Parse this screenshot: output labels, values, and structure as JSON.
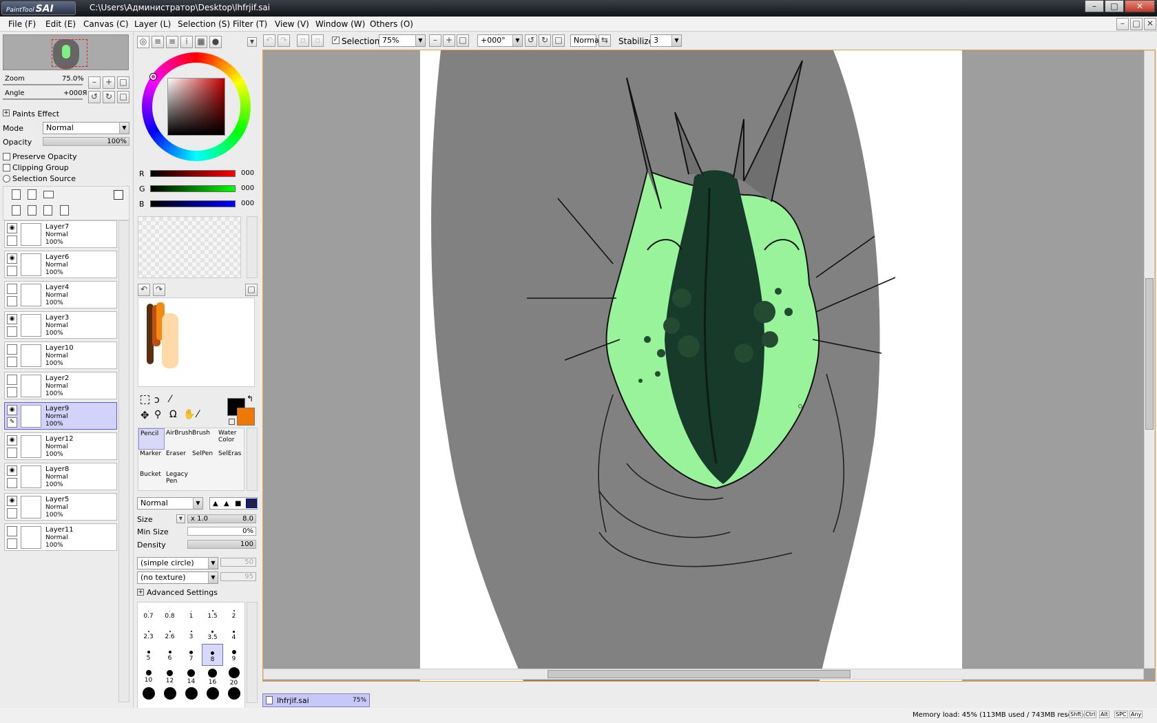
{
  "app": {
    "logo": "PaintTool SAI",
    "logo_prefix": "PaintTool",
    "logo_main": "SAI",
    "window_title": "C:\\Users\\Администратор\\Desktop\\lhfrjif.sai"
  },
  "menu": {
    "items": [
      "File (F)",
      "Edit (E)",
      "Canvas (C)",
      "Layer (L)",
      "Selection (S)",
      "Filter (T)",
      "View (V)",
      "Window (W)",
      "Others (O)"
    ]
  },
  "navigator": {
    "zoom_label": "Zoom",
    "zoom_value": "75.0%",
    "angle_label": "Angle",
    "angle_value": "+000Я"
  },
  "layer_props": {
    "paints_effect": "Paints Effect",
    "mode_label": "Mode",
    "mode_value": "Normal",
    "opacity_label": "Opacity",
    "opacity_value": "100%",
    "preserve_opacity": "Preserve Opacity",
    "clipping_group": "Clipping Group",
    "selection_source": "Selection Source"
  },
  "layers": [
    {
      "name": "Layer7",
      "mode": "Normal",
      "opacity": "100%",
      "visible": true,
      "selected": false
    },
    {
      "name": "Layer6",
      "mode": "Normal",
      "opacity": "100%",
      "visible": true,
      "selected": false
    },
    {
      "name": "Layer4",
      "mode": "Normal",
      "opacity": "100%",
      "visible": false,
      "selected": false
    },
    {
      "name": "Layer3",
      "mode": "Normal",
      "opacity": "100%",
      "visible": true,
      "selected": false
    },
    {
      "name": "Layer10",
      "mode": "Normal",
      "opacity": "100%",
      "visible": false,
      "selected": false
    },
    {
      "name": "Layer2",
      "mode": "Normal",
      "opacity": "100%",
      "visible": false,
      "selected": false
    },
    {
      "name": "Layer9",
      "mode": "Normal",
      "opacity": "100%",
      "visible": true,
      "selected": true
    },
    {
      "name": "Layer12",
      "mode": "Normal",
      "opacity": "100%",
      "visible": true,
      "selected": false
    },
    {
      "name": "Layer8",
      "mode": "Normal",
      "opacity": "100%",
      "visible": true,
      "selected": false
    },
    {
      "name": "Layer5",
      "mode": "Normal",
      "opacity": "100%",
      "visible": true,
      "selected": false
    },
    {
      "name": "Layer11",
      "mode": "Normal",
      "opacity": "100%",
      "visible": false,
      "selected": false
    }
  ],
  "color": {
    "r_label": "R",
    "r_value": "000",
    "g_label": "G",
    "g_value": "000",
    "b_label": "B",
    "b_value": "000",
    "primary": "#000000",
    "secondary": "#f07800"
  },
  "tools": [
    {
      "label": "Pencil",
      "selected": true
    },
    {
      "label": "AirBrush",
      "selected": false
    },
    {
      "label": "Brush",
      "selected": false
    },
    {
      "label": "Water Color",
      "selected": false
    },
    {
      "label": "Marker",
      "selected": false
    },
    {
      "label": "Eraser",
      "selected": false
    },
    {
      "label": "SelPen",
      "selected": false
    },
    {
      "label": "SelEras",
      "selected": false
    },
    {
      "label": "Bucket",
      "selected": false
    },
    {
      "label": "Legacy Pen",
      "selected": false
    }
  ],
  "brush": {
    "blend_mode": "Normal",
    "size_label": "Size",
    "size_mult": "x 1.0",
    "size_value": "8.0",
    "min_size_label": "Min Size",
    "min_size_value": "0%",
    "density_label": "Density",
    "density_value": "100",
    "shape": "(simple circle)",
    "shape_value": "50",
    "texture": "(no texture)",
    "texture_value": "95",
    "advanced": "Advanced Settings"
  },
  "brush_sizes": [
    {
      "label": "0.7",
      "dot": 1
    },
    {
      "label": "0.8",
      "dot": 1
    },
    {
      "label": "1",
      "dot": 1
    },
    {
      "label": "1.5",
      "dot": 2
    },
    {
      "label": "2",
      "dot": 2
    },
    {
      "label": "2.3",
      "dot": 2
    },
    {
      "label": "2.6",
      "dot": 2
    },
    {
      "label": "3",
      "dot": 2
    },
    {
      "label": "3.5",
      "dot": 3
    },
    {
      "label": "4",
      "dot": 3
    },
    {
      "label": "5",
      "dot": 4
    },
    {
      "label": "6",
      "dot": 4
    },
    {
      "label": "7",
      "dot": 5
    },
    {
      "label": "8",
      "dot": 5,
      "selected": true
    },
    {
      "label": "9",
      "dot": 6
    },
    {
      "label": "10",
      "dot": 8
    },
    {
      "label": "12",
      "dot": 9
    },
    {
      "label": "14",
      "dot": 11
    },
    {
      "label": "16",
      "dot": 13
    },
    {
      "label": "20",
      "dot": 16
    },
    {
      "label": "",
      "dot": 18
    },
    {
      "label": "",
      "dot": 18
    },
    {
      "label": "",
      "dot": 18
    },
    {
      "label": "",
      "dot": 18
    },
    {
      "label": "",
      "dot": 18
    }
  ],
  "toolbar": {
    "selection_label": "Selection",
    "zoom_value": "75%",
    "angle_value": "+000°",
    "blend": "Normal",
    "stabilizer_label": "Stabilizer",
    "stabilizer_value": "3"
  },
  "document_tab": {
    "name": "lhfrjif.sai",
    "zoom": "75%"
  },
  "status": {
    "memory": "Memory load: 45% (113MB used / 743MB reserved)",
    "keys": [
      "Shft",
      "Ctrl",
      "Alt",
      "SPC",
      "Any"
    ]
  }
}
